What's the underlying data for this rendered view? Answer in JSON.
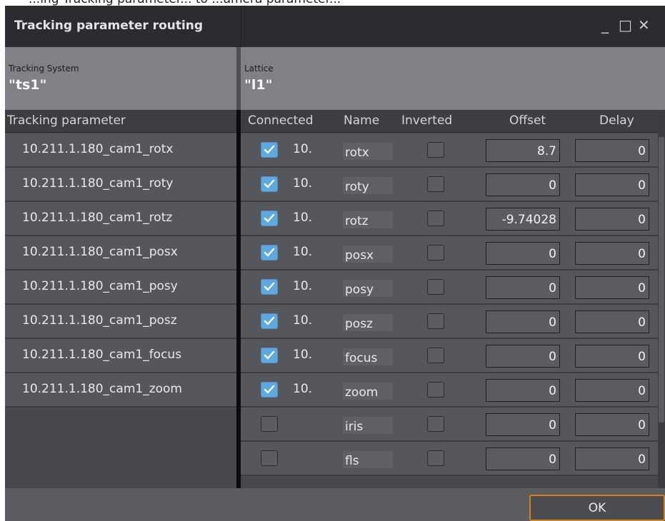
{
  "partial_caption": "...ing Tracking parameter... to ...amera parameter...",
  "window": {
    "title": "Tracking parameter routing",
    "minimize_glyph": "_",
    "maximize_glyph": "□",
    "close_glyph": "✕"
  },
  "header": {
    "tracking_system_label": "Tracking System",
    "tracking_system_value": "\"ts1\"",
    "lattice_label": "Lattice",
    "lattice_value": "\"l1\""
  },
  "columns": {
    "tracking_parameter": "Tracking parameter",
    "connected": "Connected",
    "name": "Name",
    "inverted": "Inverted",
    "offset": "Offset",
    "delay": "Delay"
  },
  "tracking_parameters": [
    "10.211.1.180_cam1_rotx",
    "10.211.1.180_cam1_roty",
    "10.211.1.180_cam1_rotz",
    "10.211.1.180_cam1_posx",
    "10.211.1.180_cam1_posy",
    "10.211.1.180_cam1_posz",
    "10.211.1.180_cam1_focus",
    "10.211.1.180_cam1_zoom"
  ],
  "rows": [
    {
      "connected": true,
      "prefix": "10.",
      "name": "rotx",
      "inverted": false,
      "offset": "8.7",
      "delay": "0"
    },
    {
      "connected": true,
      "prefix": "10.",
      "name": "roty",
      "inverted": false,
      "offset": "0",
      "delay": "0"
    },
    {
      "connected": true,
      "prefix": "10.",
      "name": "rotz",
      "inverted": false,
      "offset": "-9.74028",
      "delay": "0"
    },
    {
      "connected": true,
      "prefix": "10.",
      "name": "posx",
      "inverted": false,
      "offset": "0",
      "delay": "0"
    },
    {
      "connected": true,
      "prefix": "10.",
      "name": "posy",
      "inverted": false,
      "offset": "0",
      "delay": "0"
    },
    {
      "connected": true,
      "prefix": "10.",
      "name": "posz",
      "inverted": false,
      "offset": "0",
      "delay": "0"
    },
    {
      "connected": true,
      "prefix": "10.",
      "name": "focus",
      "inverted": false,
      "offset": "0",
      "delay": "0"
    },
    {
      "connected": true,
      "prefix": "10.",
      "name": "zoom",
      "inverted": false,
      "offset": "0",
      "delay": "0"
    },
    {
      "connected": false,
      "prefix": "",
      "name": "iris",
      "inverted": false,
      "offset": "0",
      "delay": "0"
    },
    {
      "connected": false,
      "prefix": "",
      "name": "fls",
      "inverted": false,
      "offset": "0",
      "delay": "0"
    }
  ],
  "footer": {
    "ok_label": "OK"
  },
  "colors": {
    "accent_checkbox": "#5ea7df",
    "ok_border": "#d6821b",
    "titlebar": "#2a2c2f"
  }
}
